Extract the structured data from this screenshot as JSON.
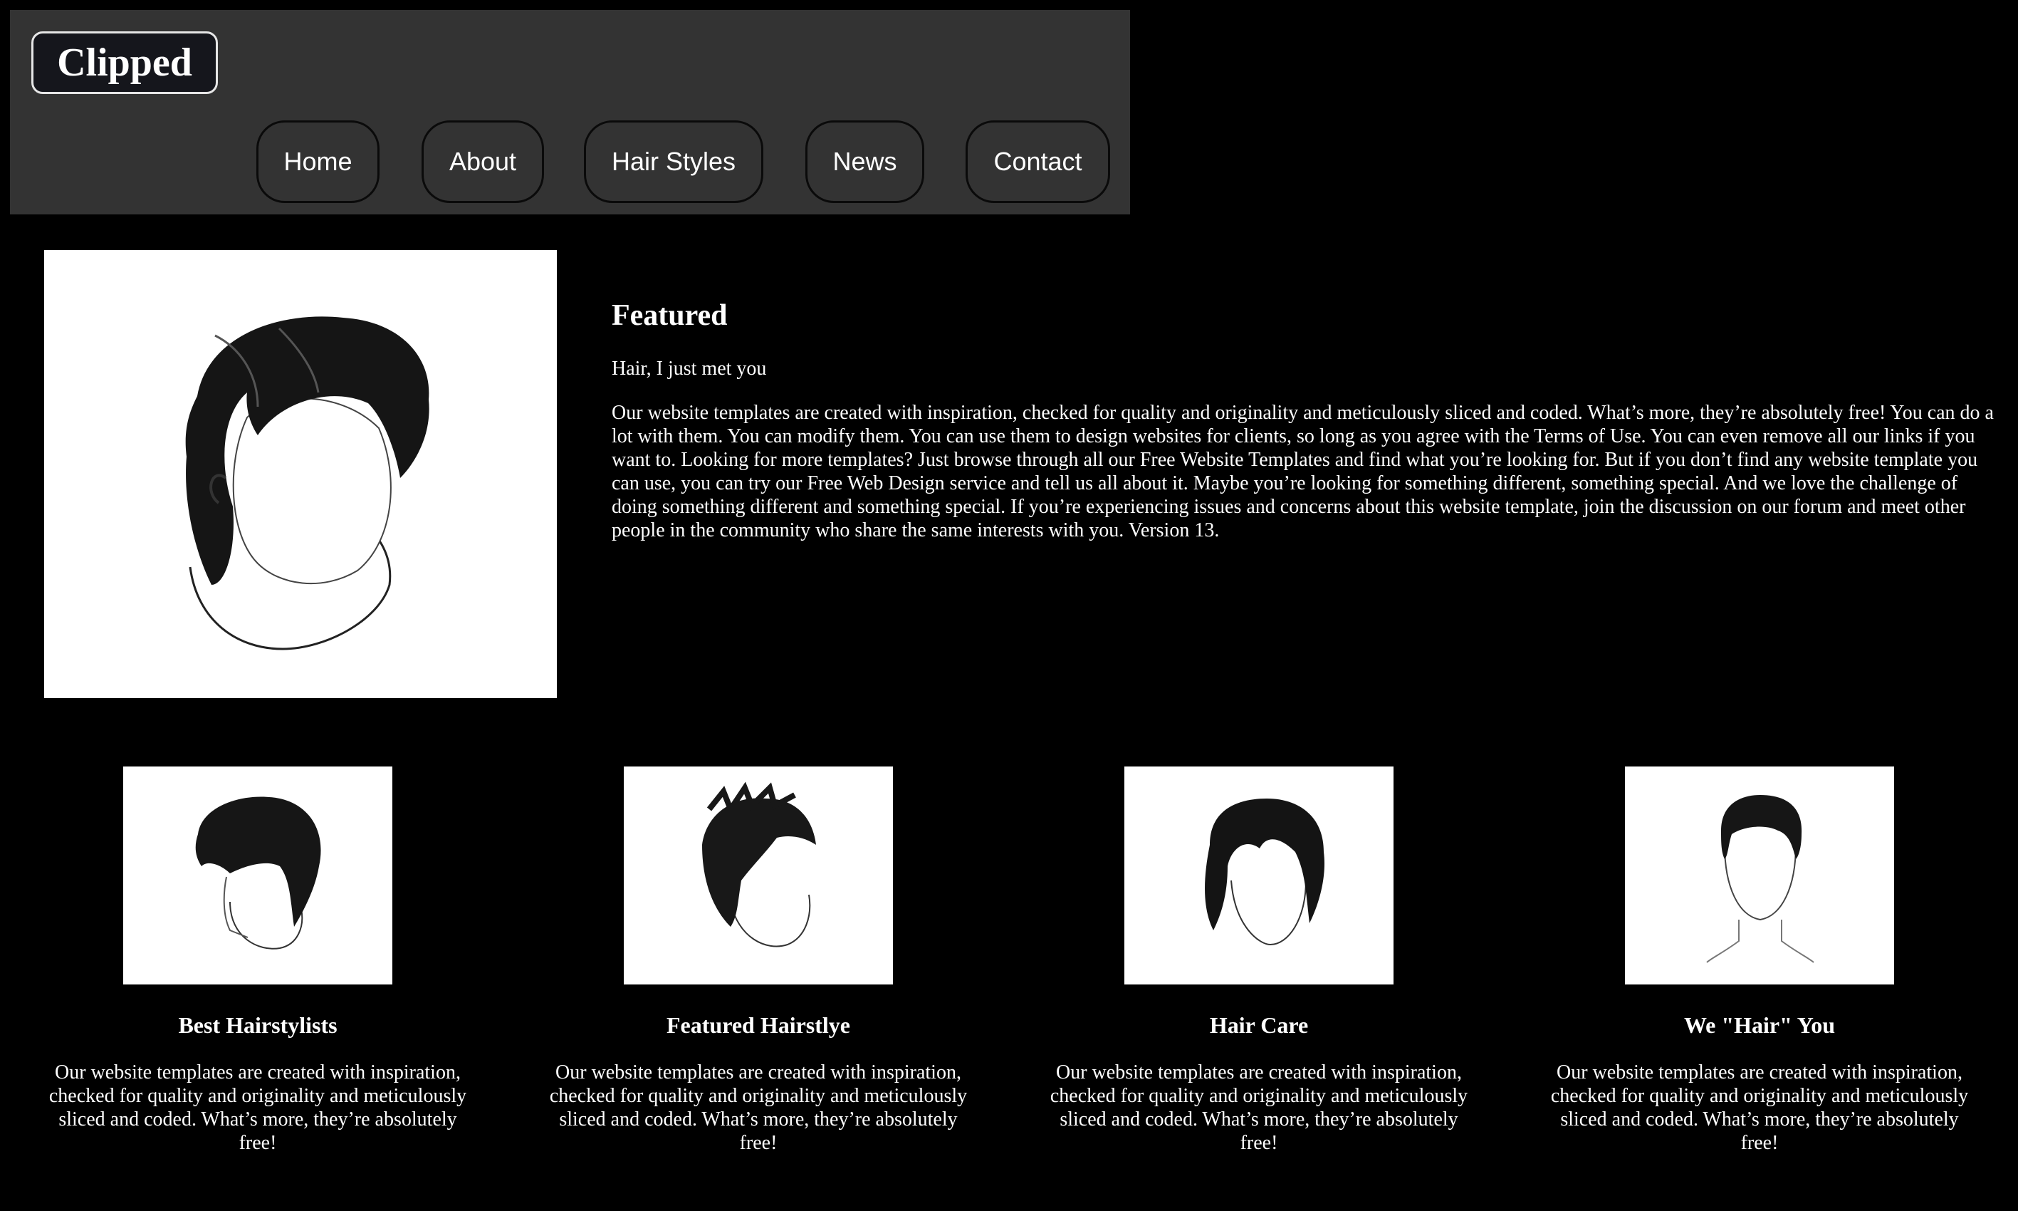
{
  "header": {
    "logo": "Clipped"
  },
  "nav": {
    "items": [
      {
        "label": "Home"
      },
      {
        "label": "About"
      },
      {
        "label": "Hair Styles"
      },
      {
        "label": "News"
      },
      {
        "label": "Contact"
      }
    ]
  },
  "featured": {
    "heading": "Featured",
    "subheading": "Hair, I just met you",
    "body": "Our website templates are created with inspiration, checked for quality and originality and meticulously sliced and coded. What’s more, they’re absolutely free! You can do a lot with them. You can modify them. You can use them to design websites for clients, so long as you agree with the Terms of Use. You can even remove all our links if you want to. Looking for more templates? Just browse through all our Free Website Templates and find what you’re looking for. But if you don’t find any website template you can use, you can try our Free Web Design service and tell us all about it. Maybe you’re looking for something different, something special. And we love the challenge of doing something different and something special. If you’re experiencing issues and concerns about this website template, join the discussion on our forum and meet other people in the community who share the same interests with you. Version 13."
  },
  "cards": [
    {
      "title": "Best Hairstylists",
      "text": "Our website templates are created with inspiration, checked for quality and originality and meticulously sliced and coded. What’s more, they’re absolutely free!"
    },
    {
      "title": "Featured Hairstlye",
      "text": "Our website templates are created with inspiration, checked for quality and originality and meticulously sliced and coded. What’s more, they’re absolutely free!"
    },
    {
      "title": "Hair Care",
      "text": "Our website templates are created with inspiration, checked for quality and originality and meticulously sliced and coded. What’s more, they’re absolutely free!"
    },
    {
      "title": "We \"Hair\" You",
      "text": "Our website templates are created with inspiration, checked for quality and originality and meticulously sliced and coded. What’s more, they’re absolutely free!"
    }
  ]
}
